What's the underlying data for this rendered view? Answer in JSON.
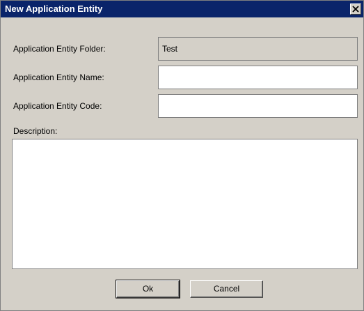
{
  "window": {
    "title": "New Application Entity"
  },
  "form": {
    "folder_label": "Application Entity Folder:",
    "folder_value": "Test",
    "name_label": "Application Entity Name:",
    "name_value": "",
    "code_label": "Application Entity Code:",
    "code_value": "",
    "description_label": "Description:",
    "description_value": ""
  },
  "buttons": {
    "ok_label": "Ok",
    "cancel_label": "Cancel"
  },
  "icons": {
    "close": "close-icon"
  },
  "colors": {
    "titlebar": "#0a246a",
    "dialog_bg": "#d4d0c8",
    "field_bg": "#ffffff"
  }
}
